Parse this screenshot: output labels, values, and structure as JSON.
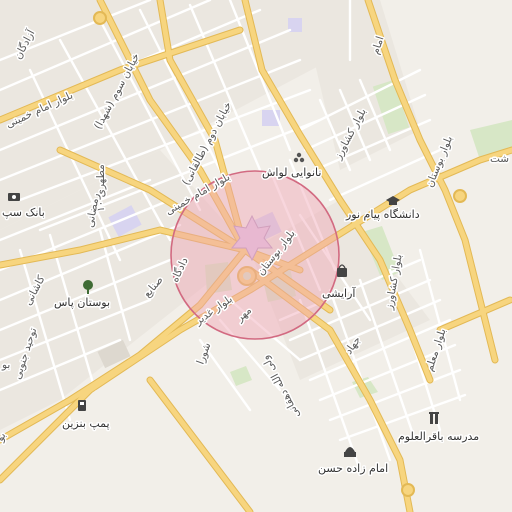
{
  "colors": {
    "land": "#f2efe9",
    "block_fill": "#ebe7e0",
    "street": "#ffffff",
    "major_road": "#f7d57f",
    "major_road_edge": "#e3b955",
    "park": "#d7e7c6",
    "blue_area": "#d8d4f0",
    "highlight_fill": "#f0a4b3",
    "highlight_stroke": "#d26a81"
  },
  "map": {
    "highlight": {
      "name": "area-highlight",
      "opacity": 0.45
    },
    "roads": {
      "azadegan": "آزادگان",
      "imam_khomeini_west": "بلوار امام خمینی",
      "khiaban_sevom": "خیابان سوم (شهدا)",
      "khiaban_dovom": "خیابان دوم (طالقانی)",
      "imam_khomeini_center": "بلوار امام خمینی",
      "keshavarz_north": "بلوار کشاورز",
      "keshavarz_east": "بلوار کشاورز",
      "bustan_east": "بلوار بوستان",
      "bustan_center": "بلوار بوستان",
      "motahari": "مطهری ۱۰",
      "ramezani": "رمضانی",
      "dadgah": "دادگاه",
      "sanayi": "صنایع",
      "kashani": "کاشانی",
      "tohid_jonubi": "توحید جنوبی",
      "bolvar_ghadir": "بلوار غدیر",
      "shora": "شورا",
      "mehr": "مهر",
      "valiollah_dehghani": "ولی الله دهقانی",
      "jahad": "جهاد",
      "bolvar_moallem": "بلوار معلم",
      "imam_top": "امام",
      "bust_fragment": "بوست",
      "bo_fragment": "بو"
    },
    "pois": {
      "bakery": "نانوایی لواش",
      "university": "دانشگاه پیام نور",
      "beauty": "آرایشی",
      "park_pas": "بوستان پاس",
      "bank_sepah": "بانک سپ",
      "gas_station": "پمپ بنزین",
      "school": "مدرسه باقرالعلوم",
      "shrine": "امام زاده حسن",
      "shat_fragment": "شت"
    },
    "icons": {
      "bakery": "bakery-icon",
      "university": "graduation-cap-icon",
      "beauty": "shopping-bag-icon",
      "park": "tree-icon",
      "bank": "atm-icon",
      "gas": "fuel-pump-icon",
      "school": "school-icon",
      "shrine": "mosque-icon"
    }
  }
}
